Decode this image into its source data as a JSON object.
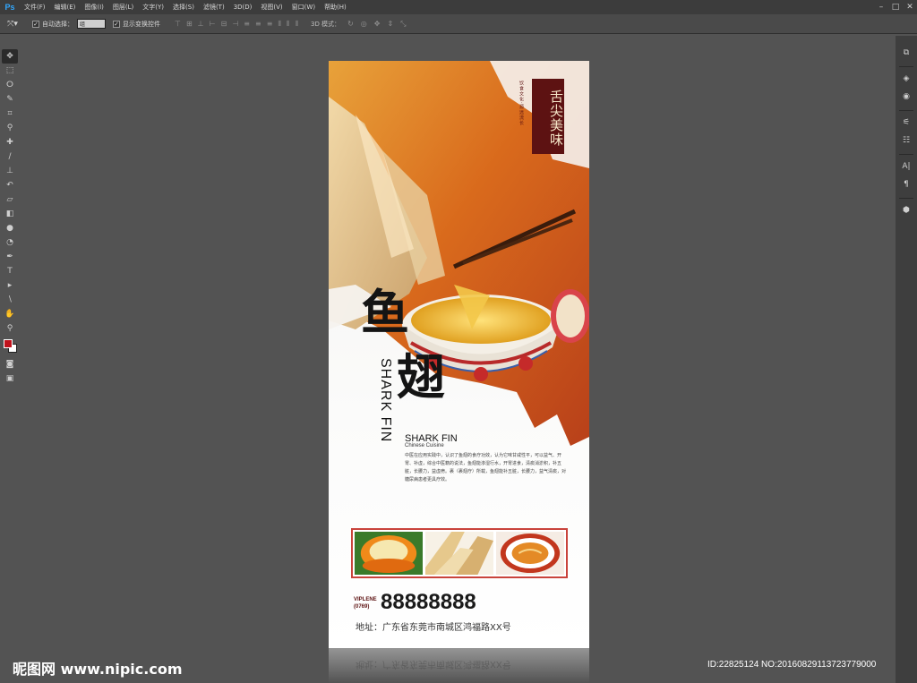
{
  "app": {
    "logo": "Ps",
    "menus": [
      "文件(F)",
      "编辑(E)",
      "图像(I)",
      "图层(L)",
      "文字(Y)",
      "选择(S)",
      "滤镜(T)",
      "3D(D)",
      "视图(V)",
      "窗口(W)",
      "帮助(H)"
    ],
    "window_controls": [
      "–",
      "□",
      "✕"
    ]
  },
  "options_bar": {
    "tool_icon": "move-tool-icon",
    "auto_select_label": "自动选择：",
    "auto_select_checked": true,
    "auto_select_value": "组",
    "show_transform_label": "显示变换控件",
    "show_transform_checked": true,
    "mode3d_label": "3D 模式："
  },
  "toolbar": {
    "tools": [
      "move-tool",
      "marquee-tool",
      "lasso-tool",
      "quick-select-tool",
      "crop-tool",
      "eyedropper-tool",
      "healing-brush-tool",
      "brush-tool",
      "clone-stamp-tool",
      "history-brush-tool",
      "eraser-tool",
      "gradient-tool",
      "blur-tool",
      "dodge-tool",
      "pen-tool",
      "type-tool",
      "path-select-tool",
      "shape-tool",
      "hand-tool",
      "zoom-tool"
    ],
    "foreground_color": "#c1121c",
    "background_color": "#ffffff"
  },
  "poster": {
    "seal_text": "舌尖美味",
    "seal_subtext": "饮食文化·源远流长",
    "title_char_1": "鱼",
    "title_char_2": "翅",
    "vertical_en": "SHARK FIN",
    "en_title": "SHARK FIN",
    "en_subtitle": "Chinese  Cuisine",
    "body": "中医在应用实践中，认识了鱼翅的食疗功效，认为它味甘咸性平，可以益气、开胃、补虚，综合中医籍的说法，鱼翅能渗湿行水，开胃进食，清痰消淤积，补五脏，长腰力，益虚痨。裹（裹翅疗）所载，鱼翅能补五脏，长腰力，益气清痰，对糖尿病患者更具疗效。",
    "phone_label_1": "VIPLENE",
    "phone_label_2": "(0769)",
    "phone": "88888888",
    "address": "地址：广东省东莞市南城区鸿福路XX号"
  },
  "watermark": {
    "left": "昵图网 www.nipic.com",
    "right": "ID:22825124 NO:20160829113723779000"
  }
}
